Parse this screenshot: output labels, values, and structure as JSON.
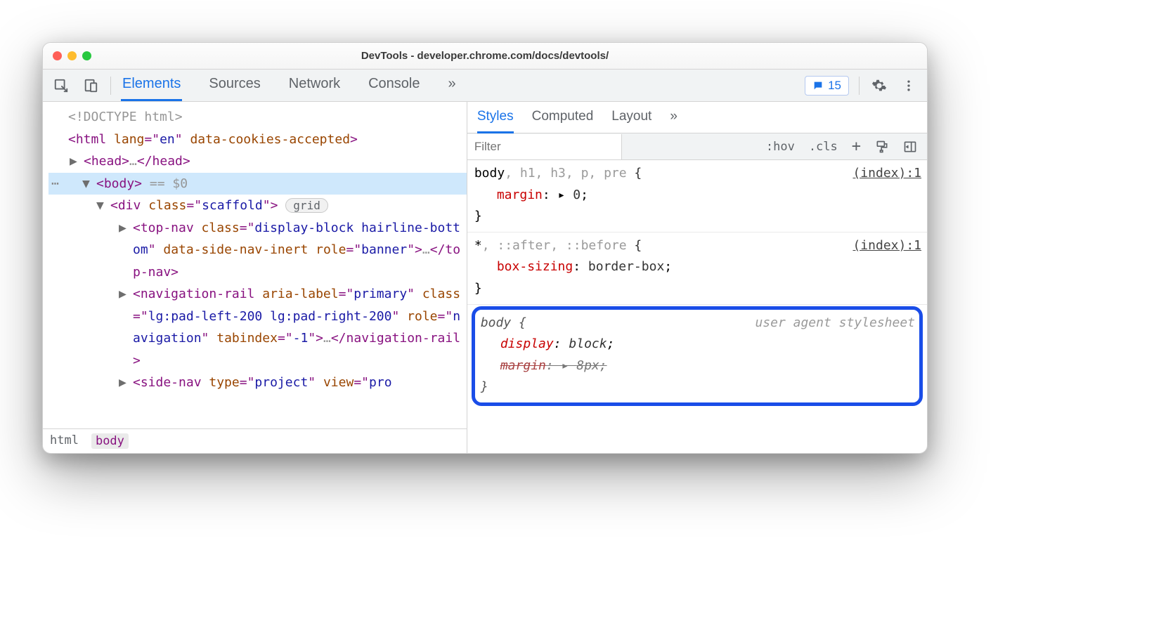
{
  "title": "DevTools - developer.chrome.com/docs/devtools/",
  "tabs": {
    "elements": "Elements",
    "sources": "Sources",
    "network": "Network",
    "console": "Console",
    "more": "»"
  },
  "issues_count": "15",
  "dom": {
    "doctype": "<!DOCTYPE html>",
    "html_open_lang": "en",
    "html_open_attr": "data-cookies-accepted",
    "head": "<head>…</head>",
    "body_eq": "== $0",
    "scaffold_class": "scaffold",
    "grid_chip": "grid",
    "topnav_open": "<top-nav class=\"display-block hairline-bottom\" data-side-nav-inert role=\"banner\">…</top-nav>",
    "navrail_open": "<navigation-rail aria-label=\"primary\" class=\"lg:pad-left-200 lg:pad-right-200\" role=\"navigation\" tabindex=\"-1\">…</navigation-rail>",
    "sidenav_partial": "<side-nav type=\"project\" view=\"pro"
  },
  "breadcrumbs": [
    "html",
    "body"
  ],
  "styles_tabs": {
    "styles": "Styles",
    "computed": "Computed",
    "layout": "Layout",
    "more": "»"
  },
  "styles_toolbar": {
    "filter_placeholder": "Filter",
    "hov": ":hov",
    "cls": ".cls"
  },
  "rules": {
    "r1": {
      "selector_first": "body",
      "selector_rest": ", h1, h3, p, pre",
      "brace_open": " {",
      "source": "(index):1",
      "prop_name": "margin",
      "prop_val": "0",
      "brace_close": "}"
    },
    "r2": {
      "selector_first": "*",
      "selector_rest": ", ::after, ::before",
      "brace_open": " {",
      "source": "(index):1",
      "prop_name": "box-sizing",
      "prop_val": "border-box",
      "brace_close": "}"
    },
    "ua": {
      "selector": "body {",
      "source": "user agent stylesheet",
      "p1_name": "display",
      "p1_val": "block",
      "p2_name": "margin",
      "p2_val": "8px",
      "brace_close": "}"
    }
  }
}
